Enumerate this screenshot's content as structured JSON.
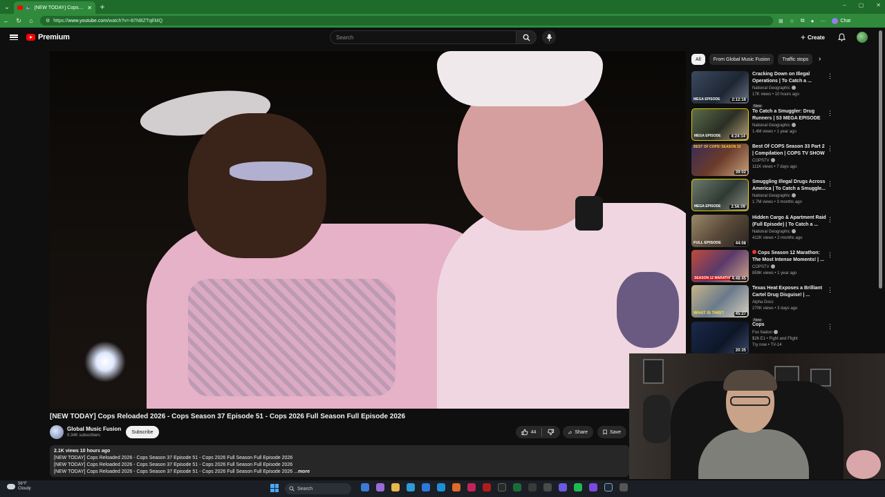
{
  "browser": {
    "tab_title": "[NEW TODAY] Cops Reloaded",
    "url_prefix": "https://",
    "url_host": "www.youtube.com",
    "url_path": "/watch?v=-87NBZTqEMQ",
    "chat_label": "Chat"
  },
  "header": {
    "logo_text": "Premium",
    "search_placeholder": "Search",
    "create_label": "Create"
  },
  "video": {
    "title": "[NEW TODAY] Cops Reloaded 2026 - Cops Season 37 Episode 51 - Cops 2026 Full Season Full Episode 2026",
    "channel_name": "Global Music Fusion",
    "channel_subs": "9.34K subscribers",
    "subscribe_label": "Subscribe",
    "like_count": "44",
    "share_label": "Share",
    "save_label": "Save",
    "views_line": "2.1K views  10 hours ago",
    "desc_lines": [
      "[NEW TODAY] Cops Reloaded 2026 - Cops Season 37 Episode 51 - Cops 2026 Full Season Full Episode 2026",
      "[NEW TODAY] Cops Reloaded 2026 - Cops Season 37 Episode 51 - Cops 2026 Full Season Full Episode 2026",
      "[NEW TODAY] Cops Reloaded 2026 - Cops Season 37 Episode 51 - Cops 2026 Full Season Full Episode 2026 ..."
    ],
    "more_label": "more"
  },
  "sidebar": {
    "chips": [
      "All",
      "From Global Music Fusion",
      "Traffic stops"
    ],
    "recommendations": [
      {
        "title": "Cracking Down on Illegal Operations | To Catch a ...",
        "channel": "National Geographic",
        "meta": "17K views • 10 hours ago",
        "badge": "New",
        "duration": "2:12:18",
        "thumb_text": "MEGA EPISODE",
        "verified": true
      },
      {
        "title": "To Catch a Smuggler: Drug Runners | S3 MEGA EPISODE",
        "channel": "National Geographic",
        "meta": "1.4M views • 1 year ago",
        "badge": "",
        "duration": "4:24:14",
        "thumb_text": "MEGA EPISODE",
        "verified": true
      },
      {
        "title": "Best Of COPS Season 33 Part 2 | Compilation | COPS TV SHOW",
        "channel": "COPSTV",
        "meta": "111K views • 7 days ago",
        "badge": "",
        "duration": "39:02",
        "thumb_text": "BEST OF COPS! SEASON 33",
        "verified": true
      },
      {
        "title": "Smuggling Illegal Drugs Across America | To Catch a Smuggle...",
        "channel": "National Geographic",
        "meta": "1.7M views • 3 months ago",
        "badge": "",
        "duration": "2:56:09",
        "thumb_text": "MEGA EPISODE",
        "verified": true
      },
      {
        "title": "Hidden Cargo & Apartment Raid (Full Episode) | To Catch a ...",
        "channel": "National Geographic",
        "meta": "412K views • 2 months ago",
        "badge": "",
        "duration": "44:08",
        "thumb_text": "FULL EPISODE",
        "verified": true
      },
      {
        "title": "Cops Season 12 Marathon: The Most Intense Moments! | ...",
        "channel": "COPSTV",
        "meta": "859K views • 1 year ago",
        "badge": "",
        "duration": "4:48:45",
        "thumb_text": "SEASON 12 MARATHON",
        "verified": true,
        "live": true
      },
      {
        "title": "Texas Heat Exposes a Brilliant Cartel Drug Disguise! | ...",
        "channel": "Alpha Docs",
        "meta": "270K views • 3 days ago",
        "badge": "New",
        "duration": "45:27",
        "thumb_text": "WHAT IS THIS?",
        "verified": false
      },
      {
        "title": "Cops",
        "channel": "Fox Nation",
        "meta": "$26 E1 • Fight and Flight",
        "badge": "Try now • TV-14",
        "duration": "20:35",
        "thumb_text": "",
        "verified": true
      }
    ]
  },
  "taskbar": {
    "temp": "56°F",
    "condition": "Cloudy",
    "search_label": "Search"
  },
  "colors": {
    "background": "#0f0f0f",
    "accent_red": "#ff0000",
    "browser_green": "#2f8a3c"
  }
}
